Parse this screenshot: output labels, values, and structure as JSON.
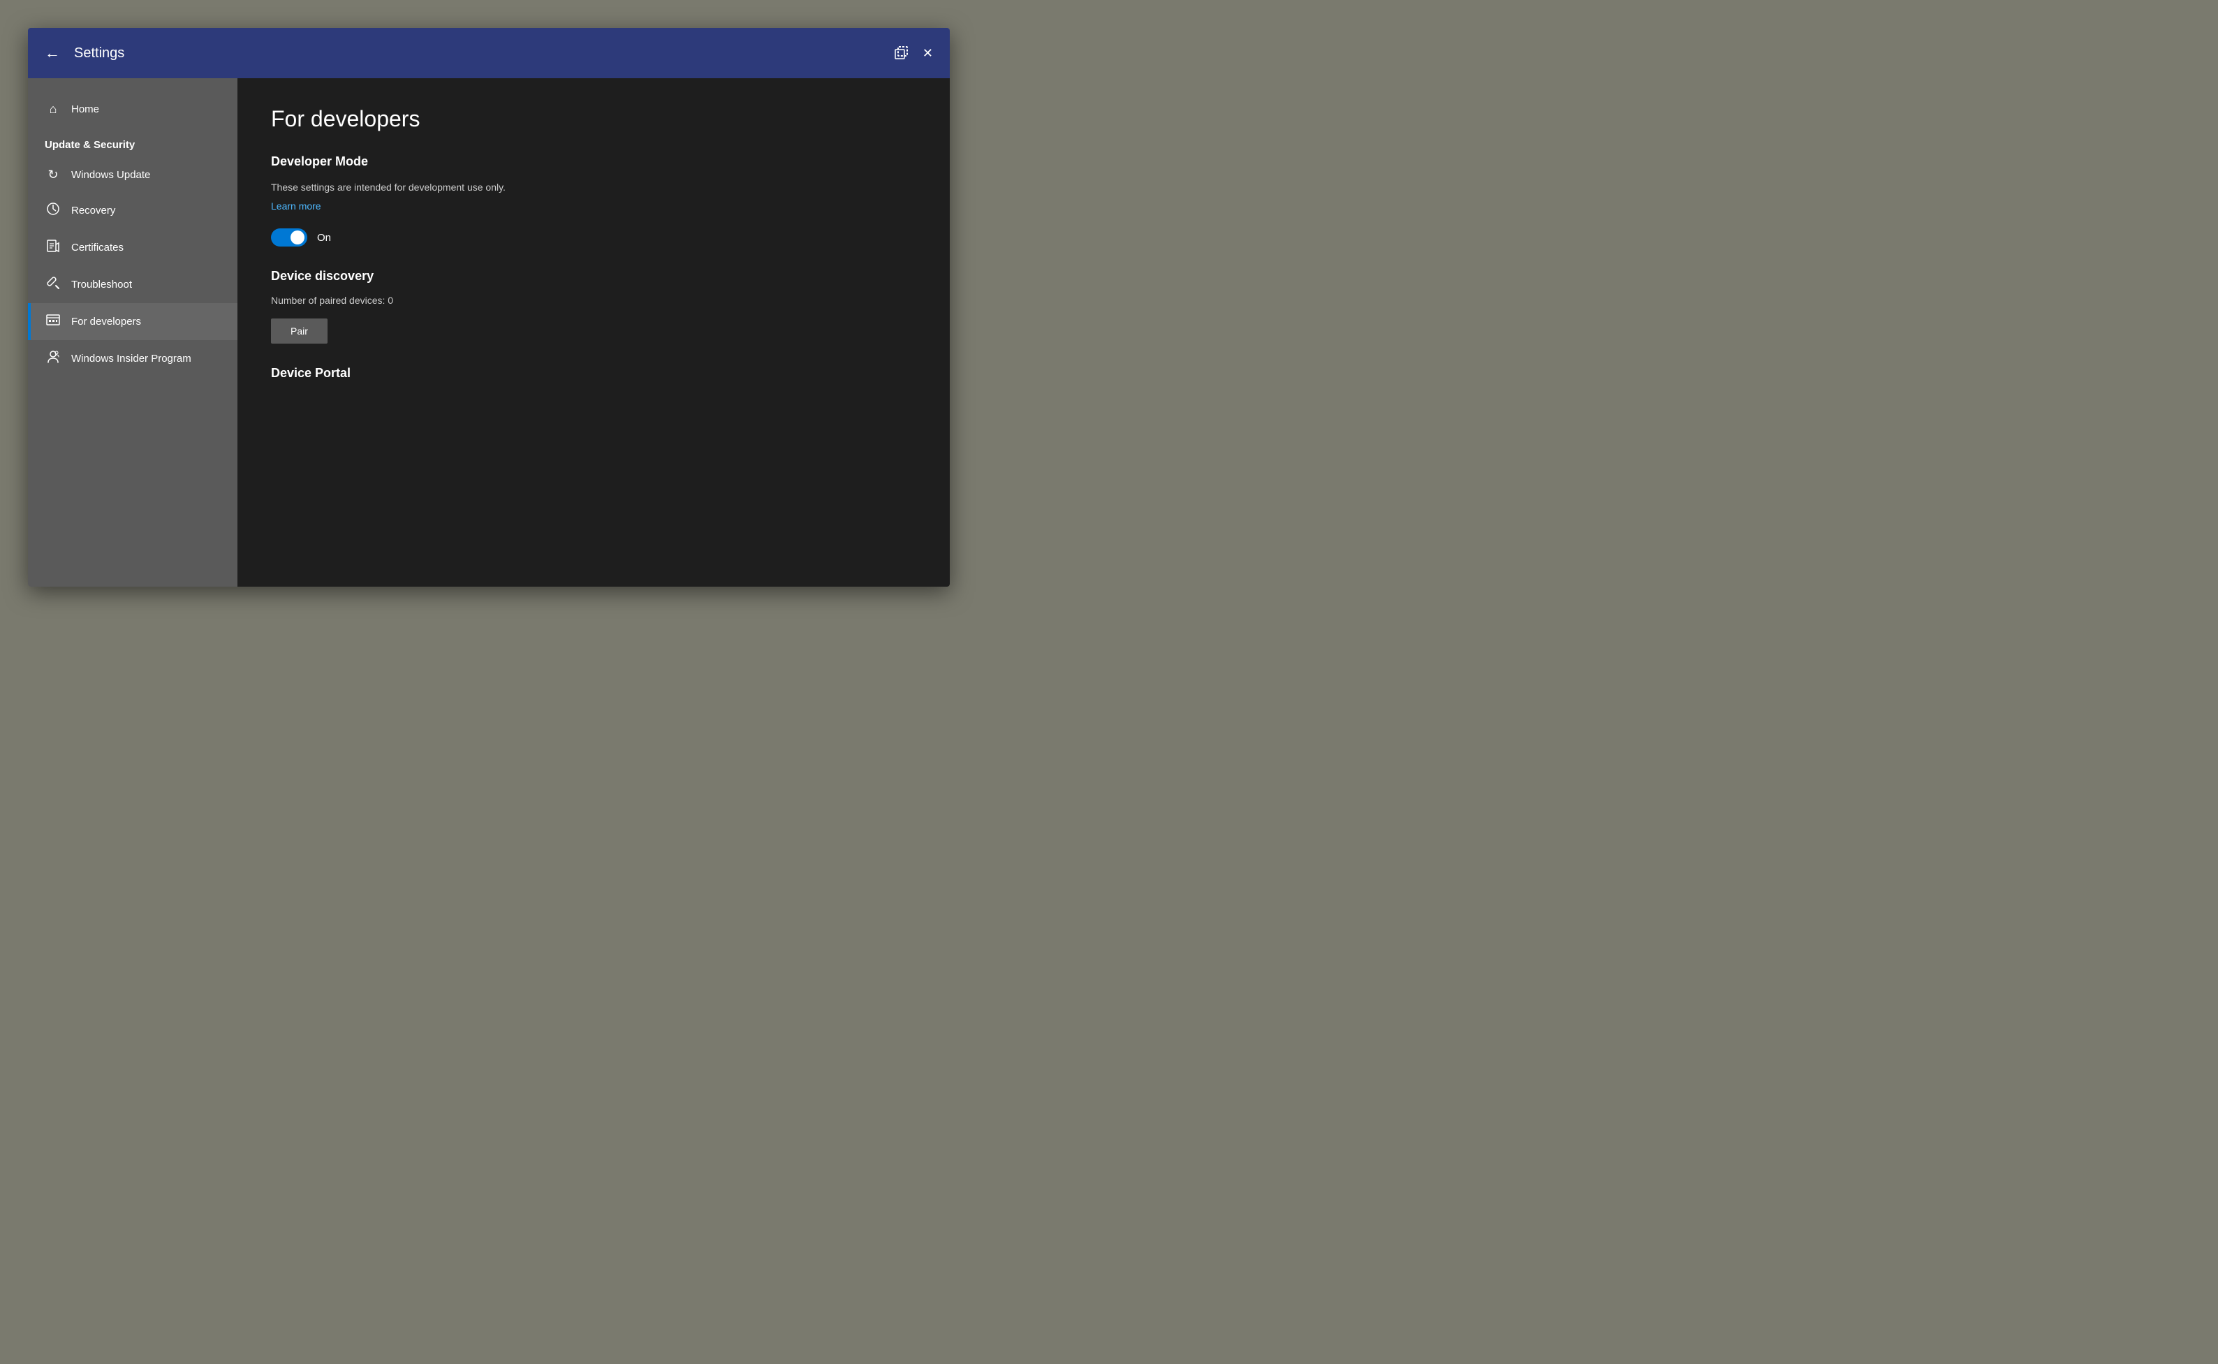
{
  "titlebar": {
    "title": "Settings",
    "back_label": "←",
    "close_label": "✕"
  },
  "sidebar": {
    "home_label": "Home",
    "section_title": "Update & Security",
    "items": [
      {
        "id": "windows-update",
        "label": "Windows Update",
        "icon": "↻"
      },
      {
        "id": "recovery",
        "label": "Recovery",
        "icon": "⏱"
      },
      {
        "id": "certificates",
        "label": "Certificates",
        "icon": "📋"
      },
      {
        "id": "troubleshoot",
        "label": "Troubleshoot",
        "icon": "🔧"
      },
      {
        "id": "for-developers",
        "label": "For developers",
        "icon": "⚙",
        "active": true
      },
      {
        "id": "windows-insider",
        "label": "Windows Insider Program",
        "icon": "👤"
      }
    ]
  },
  "main": {
    "page_title": "For developers",
    "developer_mode": {
      "section_title": "Developer Mode",
      "description": "These settings are intended for development use only.",
      "learn_more": "Learn more",
      "toggle_state": "On",
      "toggle_on": true
    },
    "device_discovery": {
      "section_title": "Device discovery",
      "paired_devices_label": "Number of paired devices: 0",
      "pair_button": "Pair"
    },
    "device_portal": {
      "section_title": "Device Portal"
    }
  }
}
